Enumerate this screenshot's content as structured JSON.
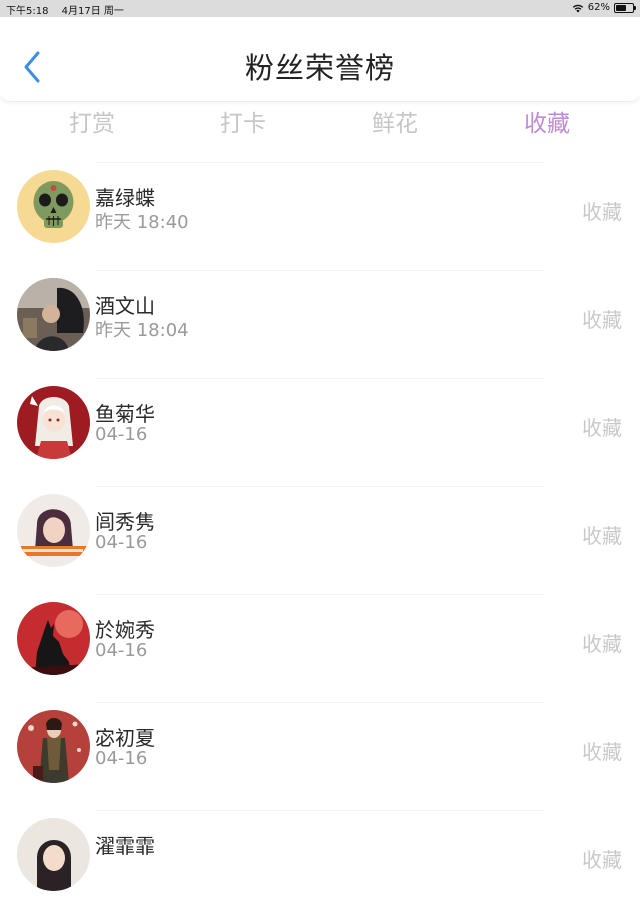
{
  "status_bar": {
    "time": "下午5:18",
    "date": "4月17日 周一",
    "battery": "62%",
    "battery_level": 0.62
  },
  "header": {
    "title": "粉丝荣誉榜",
    "back_icon": "chevron-left-icon"
  },
  "tabs": [
    {
      "label": "打赏",
      "active": false
    },
    {
      "label": "打卡",
      "active": false
    },
    {
      "label": "鲜花",
      "active": false
    },
    {
      "label": "收藏",
      "active": true
    }
  ],
  "colors": {
    "active_tab": "#c08ad8",
    "inactive_tab": "#c6c6c6",
    "back_icon": "#3a8ee6"
  },
  "fans": [
    {
      "name": "嘉绿蝶",
      "time": "昨天 18:40",
      "action": "收藏",
      "avatar": "sugar-skull"
    },
    {
      "name": "酒文山",
      "time": "昨天 18:04",
      "action": "收藏",
      "avatar": "photo-person-dark"
    },
    {
      "name": "鱼菊华",
      "time": "04-16",
      "action": "收藏",
      "avatar": "anime-red"
    },
    {
      "name": "闾秀隽",
      "time": "04-16",
      "action": "收藏",
      "avatar": "girl-portrait"
    },
    {
      "name": "於婉秀",
      "time": "04-16",
      "action": "收藏",
      "avatar": "wolf-silhouette"
    },
    {
      "name": "宓初夏",
      "time": "04-16",
      "action": "收藏",
      "avatar": "costume-red"
    },
    {
      "name": "濯霏霏",
      "time": "",
      "action": "收藏",
      "avatar": "partial-portrait"
    }
  ]
}
